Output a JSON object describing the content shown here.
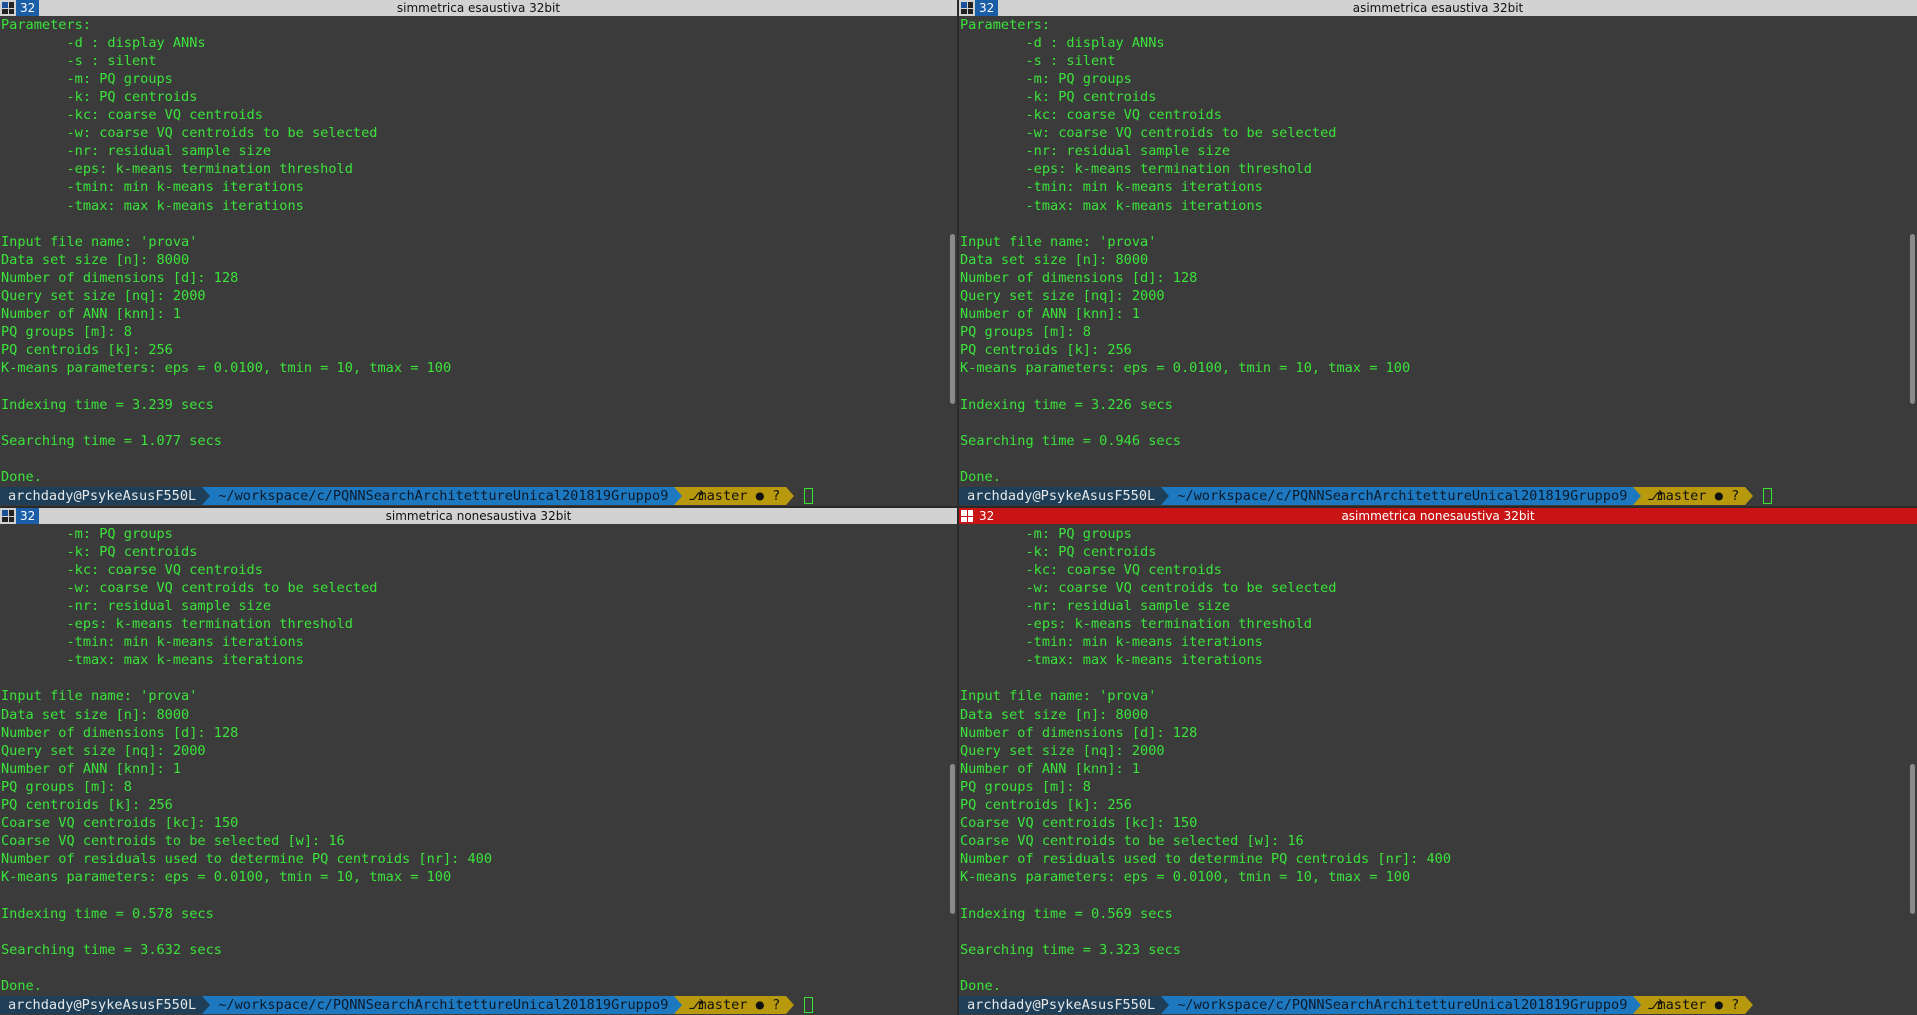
{
  "panes": [
    {
      "num": "32",
      "title": "simmetrica esaustiva 32bit",
      "lines": [
        "Parameters:",
        "        -d : display ANNs",
        "        -s : silent",
        "        -m: PQ groups",
        "        -k: PQ centroids",
        "        -kc: coarse VQ centroids",
        "        -w: coarse VQ centroids to be selected",
        "        -nr: residual sample size",
        "        -eps: k-means termination threshold",
        "        -tmin: min k-means iterations",
        "        -tmax: max k-means iterations",
        "",
        "Input file name: 'prova'",
        "Data set size [n]: 8000",
        "Number of dimensions [d]: 128",
        "Query set size [nq]: 2000",
        "Number of ANN [knn]: 1",
        "PQ groups [m]: 8",
        "PQ centroids [k]: 256",
        "K-means parameters: eps = 0.0100, tmin = 10, tmax = 100",
        "",
        "Indexing time = 3.239 secs",
        "",
        "Searching time = 1.077 secs",
        "",
        "Done."
      ]
    },
    {
      "num": "32",
      "title": "asimmetrica esaustiva 32bit",
      "lines": [
        "Parameters:",
        "        -d : display ANNs",
        "        -s : silent",
        "        -m: PQ groups",
        "        -k: PQ centroids",
        "        -kc: coarse VQ centroids",
        "        -w: coarse VQ centroids to be selected",
        "        -nr: residual sample size",
        "        -eps: k-means termination threshold",
        "        -tmin: min k-means iterations",
        "        -tmax: max k-means iterations",
        "",
        "Input file name: 'prova'",
        "Data set size [n]: 8000",
        "Number of dimensions [d]: 128",
        "Query set size [nq]: 2000",
        "Number of ANN [knn]: 1",
        "PQ groups [m]: 8",
        "PQ centroids [k]: 256",
        "K-means parameters: eps = 0.0100, tmin = 10, tmax = 100",
        "",
        "Indexing time = 3.226 secs",
        "",
        "Searching time = 0.946 secs",
        "",
        "Done."
      ]
    },
    {
      "num": "32",
      "title": "simmetrica nonesaustiva 32bit",
      "lines": [
        "        -m: PQ groups",
        "        -k: PQ centroids",
        "        -kc: coarse VQ centroids",
        "        -w: coarse VQ centroids to be selected",
        "        -nr: residual sample size",
        "        -eps: k-means termination threshold",
        "        -tmin: min k-means iterations",
        "        -tmax: max k-means iterations",
        "",
        "Input file name: 'prova'",
        "Data set size [n]: 8000",
        "Number of dimensions [d]: 128",
        "Query set size [nq]: 2000",
        "Number of ANN [knn]: 1",
        "PQ groups [m]: 8",
        "PQ centroids [k]: 256",
        "Coarse VQ centroids [kc]: 150",
        "Coarse VQ centroids to be selected [w]: 16",
        "Number of residuals used to determine PQ centroids [nr]: 400",
        "K-means parameters: eps = 0.0100, tmin = 10, tmax = 100",
        "",
        "Indexing time = 0.578 secs",
        "",
        "Searching time = 3.632 secs",
        "",
        "Done."
      ]
    },
    {
      "num": "32",
      "title": "asimmetrica nonesaustiva 32bit",
      "lines": [
        "        -m: PQ groups",
        "        -k: PQ centroids",
        "        -kc: coarse VQ centroids",
        "        -w: coarse VQ centroids to be selected",
        "        -nr: residual sample size",
        "        -eps: k-means termination threshold",
        "        -tmin: min k-means iterations",
        "        -tmax: max k-means iterations",
        "",
        "Input file name: 'prova'",
        "Data set size [n]: 8000",
        "Number of dimensions [d]: 128",
        "Query set size [nq]: 2000",
        "Number of ANN [knn]: 1",
        "PQ groups [m]: 8",
        "PQ centroids [k]: 256",
        "Coarse VQ centroids [kc]: 150",
        "Coarse VQ centroids to be selected [w]: 16",
        "Number of residuals used to determine PQ centroids [nr]: 400",
        "K-means parameters: eps = 0.0100, tmin = 10, tmax = 100",
        "",
        "Indexing time = 0.569 secs",
        "",
        "Searching time = 3.323 secs",
        "",
        "Done."
      ]
    }
  ],
  "prompt": {
    "user": "archdady@PsykeAsusF550L",
    "path": "~/workspace/c/PQNNSearchArchitettureUnical201819Gruppo9",
    "branch": "master",
    "status": "●",
    "status_q": "?"
  },
  "colors": {
    "text": "#3be33b",
    "active_title": "#c81414",
    "inactive_title": "#d2d2d2"
  }
}
